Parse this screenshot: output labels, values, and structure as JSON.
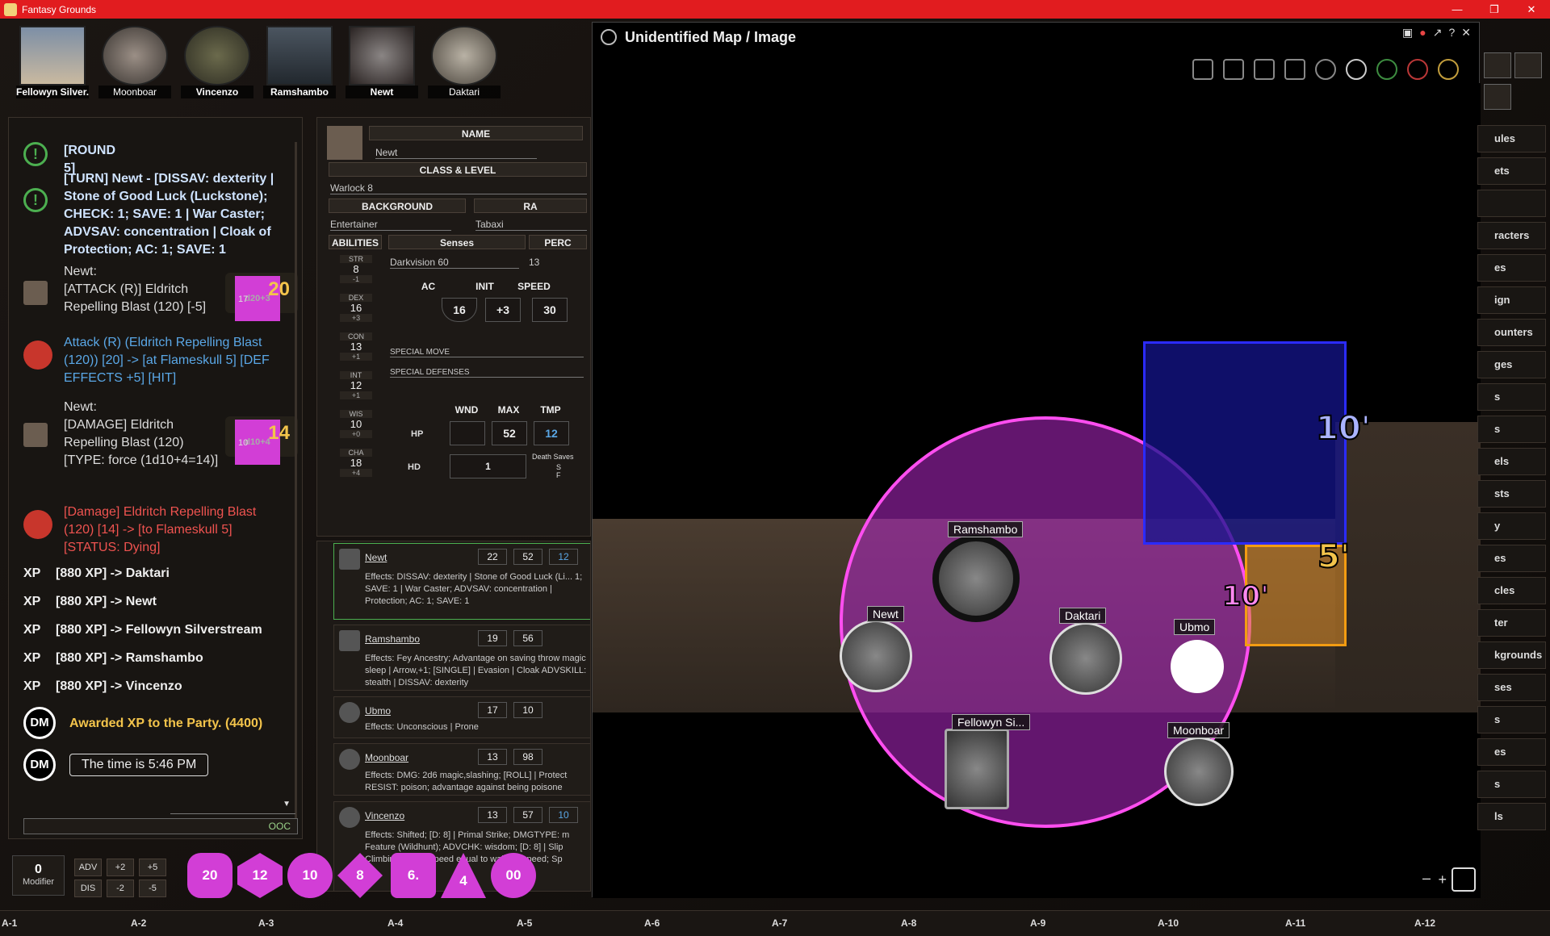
{
  "window": {
    "title": "Fantasy Grounds"
  },
  "portraits": [
    {
      "name": "Fellowyn Silver..."
    },
    {
      "name": "Moonboar"
    },
    {
      "name": "Vincenzo"
    },
    {
      "name": "Ramshambo"
    },
    {
      "name": "Newt"
    },
    {
      "name": "Daktari"
    }
  ],
  "chat": {
    "round": "[ROUND 5]",
    "turn": "[TURN] Newt - [DISSAV: dexterity | Stone of Good Luck (Luckstone); CHECK: 1; SAVE: 1 | War Caster; ADVSAV: concentration | Cloak of Protection; AC: 1; SAVE: 1",
    "attack": {
      "speaker": "Newt:",
      "text": "[ATTACK (R)] Eldritch Repelling Blast (120) [-5]",
      "die": "d20+3",
      "die_face": "17",
      "total": "20"
    },
    "attack_result": "Attack (R) (Eldritch Repelling Blast (120)) [20] -> [at Flameskull 5] [DEF EFFECTS +5] [HIT]",
    "damage": {
      "speaker": "Newt:",
      "text": "[DAMAGE] Eldritch Repelling Blast (120) [TYPE: force (1d10+4=14)]",
      "die": "d10+4",
      "die_face": "10",
      "total": "14"
    },
    "damage_result": "[Damage] Eldritch Repelling Blast (120) [14] -> [to Flameskull 5] [STATUS: Dying]",
    "xp": [
      {
        "tag": "XP",
        "text": "[880 XP] -> Daktari"
      },
      {
        "tag": "XP",
        "text": "[880 XP] -> Newt"
      },
      {
        "tag": "XP",
        "text": "[880 XP] -> Fellowyn Silverstream"
      },
      {
        "tag": "XP",
        "text": "[880 XP] -> Ramshambo"
      },
      {
        "tag": "XP",
        "text": "[880 XP] -> Vincenzo"
      }
    ],
    "dm_label": "DM",
    "awarded": "Awarded XP to the Party. (4400)",
    "time": "The time is 5:46 PM",
    "mode": "OOC"
  },
  "sheet": {
    "name_hdr": "NAME",
    "name": "Newt",
    "class_hdr": "CLASS & LEVEL",
    "class": "Warlock 8",
    "bg_hdr": "BACKGROUND",
    "bg": "Entertainer",
    "race_hdr": "RA",
    "race": "Tabaxi",
    "abilities_hdr": "ABILITIES",
    "senses_hdr": "Senses",
    "perc_hdr": "PERC",
    "senses": "Darkvision 60",
    "perc": "13",
    "abilities": [
      {
        "l": "STR",
        "v": "8",
        "m": "-1"
      },
      {
        "l": "DEX",
        "v": "16",
        "m": "+3"
      },
      {
        "l": "CON",
        "v": "13",
        "m": "+1"
      },
      {
        "l": "INT",
        "v": "12",
        "m": "+1"
      },
      {
        "l": "WIS",
        "v": "10",
        "m": "+0"
      },
      {
        "l": "CHA",
        "v": "18",
        "m": "+4"
      }
    ],
    "ac_hdr": "AC",
    "init_hdr": "INIT",
    "speed_hdr": "SPEED",
    "ac": "16",
    "init": "+3",
    "speed": "30",
    "special_move": "SPECIAL MOVE",
    "special_def": "SPECIAL DEFENSES",
    "wnd_hdr": "WND",
    "max_hdr": "MAX",
    "tmp_hdr": "TMP",
    "hp_label": "HP",
    "hp_max": "52",
    "hp_tmp": "12",
    "hd_label": "HD",
    "hd_val": "1",
    "death_saves": "Death Saves",
    "ds_s": "S",
    "ds_f": "F"
  },
  "tracker": [
    {
      "name": "Newt",
      "init": "22",
      "hp": "52",
      "extra": "12",
      "effects": "Effects: DISSAV: dexterity | Stone of Good Luck (Li... 1; SAVE: 1 | War Caster; ADVSAV: concentration | Protection; AC: 1; SAVE: 1"
    },
    {
      "name": "Ramshambo",
      "init": "19",
      "hp": "56",
      "extra": "",
      "effects": "Effects: Fey Ancestry; Advantage on saving throw magic sleep | Arrow,+1; [SINGLE] | Evasion | Cloak ADVSKILL: stealth | DISSAV: dexterity"
    },
    {
      "name": "Ubmo",
      "init": "17",
      "hp": "10",
      "extra": "",
      "effects": "Effects: Unconscious | Prone"
    },
    {
      "name": "Moonboar",
      "init": "13",
      "hp": "98",
      "extra": "",
      "effects": "Effects: DMG: 2d6 magic,slashing; [ROLL] | Protect RESIST: poison; advantage against being poisone"
    },
    {
      "name": "Vincenzo",
      "init": "13",
      "hp": "57",
      "extra": "10",
      "effects": "Effects: Shifted; [D: 8] | Primal Strike; DMGTYPE: m Feature (Wildhunt); ADVCHK: wisdom; [D: 8] | Slip Climbing: Climb speed equal to walking speed; Sp"
    }
  ],
  "modifier": {
    "value": "0",
    "label": "Modifier",
    "adv": "ADV",
    "dis": "DIS",
    "p2": "+2",
    "p5": "+5",
    "m2": "-2",
    "m5": "-5"
  },
  "dice": [
    "20",
    "12",
    "10",
    "8",
    "6.",
    "4",
    "00"
  ],
  "map": {
    "title": "Unidentified Map / Image",
    "tokens": [
      "Ramshambo",
      "Newt",
      "Daktari",
      "Ubmo",
      "Fellowyn Si...",
      "Moonboar"
    ],
    "distances": [
      "10'",
      "5'",
      "10'"
    ]
  },
  "sidebar": [
    "ules",
    "ets",
    "",
    "racters",
    "es",
    "ign",
    "ounters",
    "ges",
    "s",
    "s",
    "els",
    "sts",
    "y",
    "es",
    "cles",
    "ter",
    "kgrounds",
    "ses",
    "s",
    "es",
    "s",
    "ls"
  ],
  "ruler": [
    "A-1",
    "A-2",
    "A-3",
    "A-4",
    "A-5",
    "A-6",
    "A-7",
    "A-8",
    "A-9",
    "A-10",
    "A-11",
    "A-12"
  ]
}
